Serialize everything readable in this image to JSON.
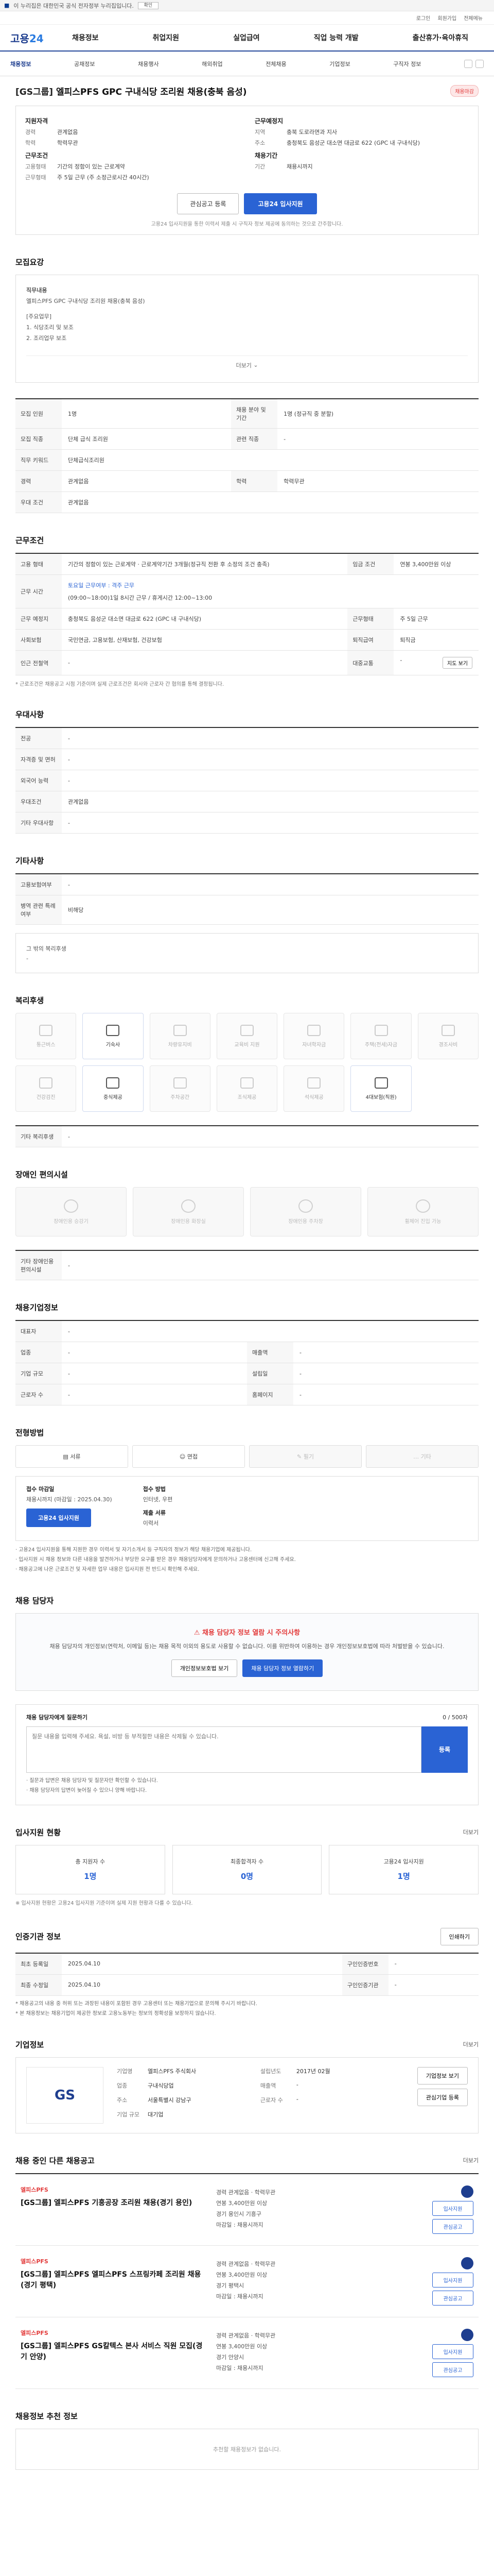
{
  "topbar": {
    "gov_text": "이 누리집은 대한민국 공식 전자정부 누리집입니다.",
    "ok": "확인"
  },
  "util": {
    "login": "로그인",
    "join": "회원가입",
    "sitemap": "전체메뉴"
  },
  "gnb": {
    "logo_a": "고용",
    "logo_b": "24",
    "menu": [
      "채용정보",
      "취업지원",
      "실업급여",
      "직업 능력 개발",
      "출산휴가·육아휴직"
    ]
  },
  "snb": {
    "home": "채용정보",
    "items": [
      "공채정보",
      "채용행사",
      "해외취업",
      "전체채용",
      "기업정보",
      "구직자 정보"
    ]
  },
  "title": {
    "company": "[GS그룹]",
    "text": "엘피스PFS GPC 구내식당 조리원 채용(충북 음성)",
    "status": "채용마감"
  },
  "summary": {
    "left_title": "지원자격",
    "left": [
      {
        "k": "경력",
        "v": "관계없음"
      },
      {
        "k": "학력",
        "v": "학력무관"
      }
    ],
    "left2_title": "근무조건",
    "left2": [
      {
        "k": "고용형태",
        "v": "기간의 정함이 있는 근로계약"
      },
      {
        "k": "근무형태",
        "v": "주 5일 근무 (주 소정근로시간 40시간)"
      }
    ],
    "right_title": "근무예정지",
    "right": [
      {
        "k": "지역",
        "v": "충북 도로라면과 지사"
      },
      {
        "k": "주소",
        "v": "충청북도 음성군 대소면 대금로 622 (GPC 내 구내식당)"
      }
    ],
    "right2_title": "채용기간",
    "right2": [
      {
        "k": "기간",
        "v": "채용시까지"
      }
    ],
    "btn_save": "관심공고 등록",
    "btn_apply": "고용24 입사지원",
    "notice": "고용24 입사지원을 통한 이력서 제출 시 구직자 정보 제공에 동의하는 것으로 간주합니다."
  },
  "recruit": {
    "title": "모집요강",
    "job_title_label": "직무내용",
    "job_title": "엘피스PFS GPC 구내식당 조리원 채용(충북 음성)",
    "duties_label": "[주요업무]",
    "duties": [
      "1. 식당조리 및 보조",
      "2. 조리업무 보조"
    ],
    "more": "더보기",
    "table": [
      {
        "k": "모집 인원",
        "v": "1명",
        "k2": "채용 분야 및 기간",
        "v2": "1명 (정규직 중 분할)"
      },
      {
        "k": "모집 직종",
        "v": "단체 급식 조리원",
        "k2": "관련 직종",
        "v2": "-"
      },
      {
        "k": "직무 키워드",
        "v": "단체급식조리원",
        "k2": "",
        "v2": ""
      },
      {
        "k": "경력",
        "v": "관계없음",
        "k2": "학력",
        "v2": "학력무관"
      },
      {
        "k": "우대 조건",
        "v": "관계없음",
        "k2": "",
        "v2": ""
      }
    ]
  },
  "conditions": {
    "title": "근무조건",
    "employ_k": "고용 형태",
    "employ_v": "기간의 정함이 있는 근로계약 · 근로계약기간 3개월(정규직 전환 후 소정의 조건 충족)",
    "place_k": "임금 조건",
    "place_v": "연봉 3,400만원 이상",
    "work_hours_k": "근무 시간",
    "work_hours_note": "토요일 근무여부 : 격주 근무",
    "work_hours_v": "(09:00~18:00)1일 8시간 근무 / 휴게시간 12:00~13:00",
    "location_k": "근무 예정지",
    "location_v": "충청북도 음성군 대소면 대금로 622 (GPC 내 구내식당)",
    "shift_k": "근무형태",
    "shift_v": "주 5일 근무",
    "insurance_k": "사회보험",
    "insurance_v": "국민연금, 고용보험, 산재보험, 건강보험",
    "retire_k": "퇴직급여",
    "retire_v": "퇴직금",
    "near_k": "인근 전철역",
    "near_v": "-",
    "region_k": "대중교통",
    "region_v": "-",
    "map_btn": "지도 보기",
    "note": "* 근로조건은 채용공고 시점 기준이며 실제 근로조건은 회사와 근로자 간 협의를 통해 결정됩니다."
  },
  "preferred": {
    "title": "우대사항",
    "rows": [
      {
        "k": "전공",
        "v": "-"
      },
      {
        "k": "자격증 및 면허",
        "v": "-"
      },
      {
        "k": "외국어 능력",
        "v": "-"
      },
      {
        "k": "우대조건",
        "v": "관계없음"
      },
      {
        "k": "기타 우대사항",
        "v": "-"
      }
    ]
  },
  "etc": {
    "title": "기타사항",
    "rows": [
      {
        "k": "고용보험여부",
        "v": "-"
      },
      {
        "k": "병역 관련 특례 여부",
        "v": "비해당"
      }
    ],
    "extra_k": "그 밖의 복리후생",
    "extra_v": "-"
  },
  "welfare": {
    "title": "복리후생",
    "items": [
      {
        "label": "통근버스",
        "on": false
      },
      {
        "label": "기숙사",
        "on": true
      },
      {
        "label": "차량유지비",
        "on": false
      },
      {
        "label": "교육비 지원",
        "on": false
      },
      {
        "label": "자녀학자금",
        "on": false
      },
      {
        "label": "주택(전세)자금",
        "on": false
      },
      {
        "label": "경조사비",
        "on": false
      },
      {
        "label": "건강검진",
        "on": false
      },
      {
        "label": "중식제공",
        "on": true
      },
      {
        "label": "주차공간",
        "on": false
      },
      {
        "label": "조식제공",
        "on": false
      },
      {
        "label": "석식제공",
        "on": false
      },
      {
        "label": "4대보험(직원)",
        "on": true
      }
    ],
    "extra_k": "기타 복리후생",
    "extra_v": "-"
  },
  "disability": {
    "title": "장애인 편의시설",
    "items": [
      "장애인용 승강기",
      "장애인용 화장실",
      "장애인용 주차장",
      "휠체어 진입 가능"
    ],
    "extra_k": "기타 장애인용 편의시설",
    "extra_v": "-"
  },
  "company_info": {
    "title": "채용기업정보",
    "rows": [
      {
        "k": "대표자",
        "v": "-",
        "k2": "",
        "v2": ""
      },
      {
        "k": "업종",
        "v": "-",
        "k2": "매출액",
        "v2": "-"
      },
      {
        "k": "기업 규모",
        "v": "-",
        "k2": "설립일",
        "v2": "-"
      },
      {
        "k": "근로자 수",
        "v": "-",
        "k2": "홈페이지",
        "v2": "-"
      }
    ]
  },
  "process": {
    "title": "전형방법",
    "steps": [
      {
        "label": "서류",
        "on": true
      },
      {
        "label": "면접",
        "on": true
      },
      {
        "label": "필기",
        "on": false
      },
      {
        "label": "기타",
        "on": false
      }
    ],
    "deadline_lab": "접수 마감일",
    "deadline_val": "채용시까지 (마감일 : 2025.04.30)",
    "method_lab": "접수 방법",
    "method_val": "인터넷, 우편",
    "apply_btn": "고용24 입사지원",
    "form_lab": "제출 서류",
    "form_val": "이력서",
    "notes": [
      "· 고용24 입사지원을 통해 지원한 경우 이력서 및 자기소개서 등 구직자의 정보가 해당 채용기업에 제공됩니다.",
      "· 입사지원 시 채용 정보와 다른 내용을 발견하거나 부당한 요구를 받은 경우 채용담당자에게 문의하거나 고용센터에 신고해 주세요.",
      "· 채용공고에 나온 근로조건 및 자세한 업무 내용은 입사지원 전 반드시 확인해 주세요."
    ]
  },
  "safety": {
    "title": "채용 담당자",
    "head": "채용 담당자 정보 열람 시 주의사항",
    "sub": "채용 담당자의 개인정보(연락처, 이메일 등)는 채용 목적 이외의 용도로 사용할 수 없습니다. 이를 위반하여 이용하는 경우 개인정보보호법에 따라 처벌받을 수 있습니다.",
    "btn1": "개인정보보호법 보기",
    "btn2": "채용 담당자 정보 열람하기"
  },
  "question": {
    "head": "채용 담당자에게 질문하기",
    "count": "0 / 500자",
    "placeholder": "질문 내용을 입력해 주세요. 욕설, 비방 등 부적절한 내용은 삭제될 수 있습니다.",
    "btn": "등록",
    "notes": [
      "· 질문과 답변은 채용 담당자 및 질문자만 확인할 수 있습니다.",
      "· 채용 담당자의 답변이 늦어질 수 있으니 양해 바랍니다."
    ]
  },
  "stats": {
    "title": "입사지원 현황",
    "more": "더보기",
    "items": [
      {
        "label": "총 지원자 수",
        "value": "1명"
      },
      {
        "label": "최종합격자 수",
        "value": "0명"
      },
      {
        "label": "고용24 입사지원",
        "value": "1명"
      }
    ],
    "note": "※ 입사지원 현황은 고용24 입사지원 기준이며 실제 지원 현황과 다를 수 있습니다."
  },
  "posting": {
    "title": "인증기관 정보",
    "print_btn": "인쇄하기",
    "rows": [
      {
        "k": "최초 등록일",
        "v": "2025.04.10",
        "k2": "구인인증번호",
        "v2": "-"
      },
      {
        "k": "최종 수정일",
        "v": "2025.04.10",
        "k2": "구인인증기관",
        "v2": "-"
      }
    ],
    "notes": [
      "* 채용공고의 내용 중 허위 또는 과장된 내용이 포함된 경우 고용센터 또는 채용기업으로 문의해 주시기 바랍니다.",
      "* 본 채용정보는 채용기업이 제공한 정보로 고용노동부는 정보의 정확성을 보장하지 않습니다."
    ]
  },
  "company": {
    "title": "기업정보",
    "more": "더보기",
    "logo_text": "GS",
    "info": [
      {
        "k": "기업명",
        "v": "엘피스PFS 주식회사",
        "k2": "설립년도",
        "v2": "2017년 02월"
      },
      {
        "k": "업종",
        "v": "구내식당업",
        "k2": "매출액",
        "v2": "-"
      },
      {
        "k": "주소",
        "v": "서울특별시 강남구",
        "k2": "근로자 수",
        "v2": "-"
      },
      {
        "k": "기업 규모",
        "v": "대기업",
        "k2": "",
        "v2": ""
      }
    ],
    "btn1": "기업정보 보기",
    "btn2": "관심기업 등록"
  },
  "similar": {
    "title": "채용 중인 다른 채용공고",
    "more": "더보기",
    "jobs": [
      {
        "company": "엘피스PFS",
        "title": "[GS그룹] 엘피스PFS 기흥공장 조리원 채용(경기 용인)",
        "lines": [
          "경력 관계없음 · 학력무관",
          "연봉 3,400만원 이상",
          "경기 용인시 기흥구",
          "마감일 : 채용시까지"
        ],
        "btn1": "입사지원",
        "btn2": "관심공고"
      },
      {
        "company": "엘피스PFS",
        "title": "[GS그룹] 엘피스PFS 엘피스PFS 스프링카페 조리원 채용(경기 평택)",
        "lines": [
          "경력 관계없음 · 학력무관",
          "연봉 3,400만원 이상",
          "경기 평택시",
          "마감일 : 채용시까지"
        ],
        "btn1": "입사지원",
        "btn2": "관심공고"
      },
      {
        "company": "엘피스PFS",
        "title": "[GS그룹] 엘피스PFS GS칼텍스 본사 서비스 직원 모집(경기 안양)",
        "lines": [
          "경력 관계없음 · 학력무관",
          "연봉 3,400만원 이상",
          "경기 안양시",
          "마감일 : 채용시까지"
        ],
        "btn1": "입사지원",
        "btn2": "관심공고"
      }
    ]
  },
  "recommend": {
    "title": "채용정보 추천 정보",
    "empty": "추천할 채용정보가 없습니다."
  }
}
